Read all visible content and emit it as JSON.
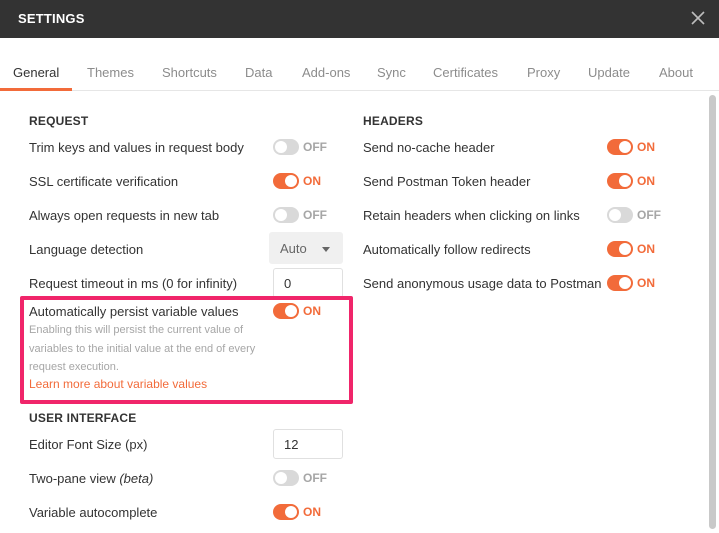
{
  "window": {
    "title": "SETTINGS",
    "close_icon": "close-icon"
  },
  "tabs": [
    {
      "label": "General",
      "active": true
    },
    {
      "label": "Themes",
      "active": false
    },
    {
      "label": "Shortcuts",
      "active": false
    },
    {
      "label": "Data",
      "active": false
    },
    {
      "label": "Add-ons",
      "active": false
    },
    {
      "label": "Sync",
      "active": false
    },
    {
      "label": "Certificates",
      "active": false
    },
    {
      "label": "Proxy",
      "active": false
    },
    {
      "label": "Update",
      "active": false
    },
    {
      "label": "About",
      "active": false
    }
  ],
  "request": {
    "title": "REQUEST",
    "trim_keys": {
      "label": "Trim keys and values in request body",
      "state": "OFF"
    },
    "ssl": {
      "label": "SSL certificate verification",
      "state": "ON"
    },
    "new_tab": {
      "label": "Always open requests in new tab",
      "state": "OFF"
    },
    "language": {
      "label": "Language detection",
      "value": "Auto"
    },
    "timeout": {
      "label": "Request timeout in ms (0 for infinity)",
      "value": "0"
    },
    "persist": {
      "label": "Automatically persist variable values",
      "state": "ON",
      "help": "Enabling this will persist the current value of variables to the initial value at the end of every request execution.",
      "link": "Learn more about variable values"
    }
  },
  "ui": {
    "title": "USER INTERFACE",
    "font_size": {
      "label": "Editor Font Size (px)",
      "value": "12"
    },
    "two_pane": {
      "label": "Two-pane view",
      "label_suffix": "(beta)",
      "state": "OFF"
    },
    "autocomplete": {
      "label": "Variable autocomplete",
      "state": "ON"
    }
  },
  "headers": {
    "title": "HEADERS",
    "no_cache": {
      "label": "Send no-cache header",
      "state": "ON"
    },
    "postman_token": {
      "label": "Send Postman Token header",
      "state": "ON"
    },
    "retain": {
      "label": "Retain headers when clicking on links",
      "state": "OFF"
    },
    "redirects": {
      "label": "Automatically follow redirects",
      "state": "ON"
    },
    "usage": {
      "label": "Send anonymous usage data to Postman",
      "state": "ON"
    }
  },
  "colors": {
    "accent": "#f26b3a",
    "highlight": "#f0256a",
    "titlebar": "#333333"
  }
}
